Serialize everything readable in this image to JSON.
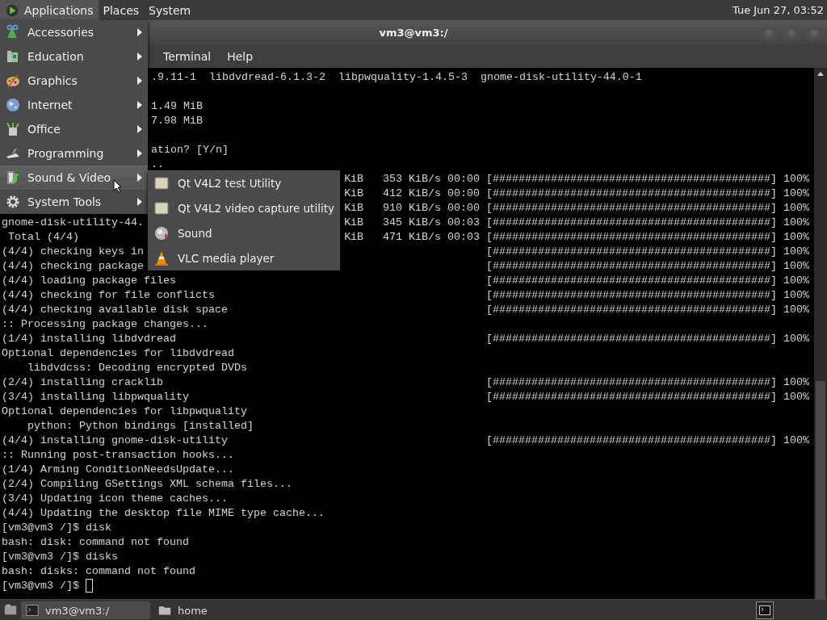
{
  "top_panel": {
    "menus": [
      {
        "label": "Applications",
        "selected": true
      },
      {
        "label": "Places",
        "selected": false
      },
      {
        "label": "System",
        "selected": false
      }
    ],
    "clock": "Tue Jun 27, 03:52"
  },
  "window": {
    "title": "vm3@vm3:/",
    "menus": [
      "Terminal",
      "Help"
    ]
  },
  "terminal": {
    "lines": [
      {
        "kind": "cut",
        "left": ".9.11-1  libdvdread-6.1.3-2  libpwquality-1.4.5-3  gnome-disk-utility-44.0-1"
      },
      {
        "kind": "blank"
      },
      {
        "kind": "cut",
        "left": "1.49 MiB"
      },
      {
        "kind": "cut",
        "left": "7.98 MiB"
      },
      {
        "kind": "blank"
      },
      {
        "kind": "cut",
        "left": "ation? [Y/n]"
      },
      {
        "kind": "cut",
        "left": ".."
      },
      {
        "kind": "line",
        "right": "KiB   353 KiB/s 00:00 [###########################################] 100%"
      },
      {
        "kind": "line",
        "right": "KiB   412 KiB/s 00:00 [###########################################] 100%"
      },
      {
        "kind": "line",
        "right": "KiB   910 KiB/s 00:00 [###########################################] 100%"
      },
      {
        "kind": "line",
        "left": "gnome-disk-utility-44.",
        "right": "KiB   345 KiB/s 00:03 [###########################################] 100%"
      },
      {
        "kind": "line",
        "left": " Total (4/4)",
        "right": "KiB   471 KiB/s 00:03 [###########################################] 100%"
      },
      {
        "kind": "line",
        "left": "(4/4) checking keys in",
        "right": "[###########################################] 100%"
      },
      {
        "kind": "line",
        "left": "(4/4) checking package",
        "right": "[###########################################] 100%"
      },
      {
        "kind": "line",
        "left": "(4/4) loading package files",
        "right": "[###########################################] 100%"
      },
      {
        "kind": "line",
        "left": "(4/4) checking for file conflicts",
        "right": "[###########################################] 100%"
      },
      {
        "kind": "line",
        "left": "(4/4) checking available disk space",
        "right": "[###########################################] 100%"
      },
      {
        "kind": "line",
        "left": ":: Processing package changes..."
      },
      {
        "kind": "line",
        "left": "(1/4) installing libdvdread",
        "right": "[###########################################] 100%"
      },
      {
        "kind": "line",
        "left": "Optional dependencies for libdvdread"
      },
      {
        "kind": "line",
        "left": "    libdvdcss: Decoding encrypted DVDs"
      },
      {
        "kind": "line",
        "left": "(2/4) installing cracklib",
        "right": "[###########################################] 100%"
      },
      {
        "kind": "line",
        "left": "(3/4) installing libpwquality",
        "right": "[###########################################] 100%"
      },
      {
        "kind": "line",
        "left": "Optional dependencies for libpwquality"
      },
      {
        "kind": "line",
        "left": "    python: Python bindings [installed]"
      },
      {
        "kind": "line",
        "left": "(4/4) installing gnome-disk-utility",
        "right": "[###########################################] 100%"
      },
      {
        "kind": "line",
        "left": ":: Running post-transaction hooks..."
      },
      {
        "kind": "line",
        "left": "(1/4) Arming ConditionNeedsUpdate..."
      },
      {
        "kind": "line",
        "left": "(2/4) Compiling GSettings XML schema files..."
      },
      {
        "kind": "line",
        "left": "(3/4) Updating icon theme caches..."
      },
      {
        "kind": "line",
        "left": "(4/4) Updating the desktop file MIME type cache..."
      },
      {
        "kind": "line",
        "left": "[vm3@vm3 /]$ disk"
      },
      {
        "kind": "line",
        "left": "bash: disk: command not found"
      },
      {
        "kind": "line",
        "left": "[vm3@vm3 /]$ disks"
      },
      {
        "kind": "line",
        "left": "bash: disks: command not found"
      },
      {
        "kind": "prompt",
        "left": "[vm3@vm3 /]$"
      }
    ]
  },
  "applications_menu": {
    "items": [
      {
        "label": "Accessories",
        "selected": false
      },
      {
        "label": "Education",
        "selected": false
      },
      {
        "label": "Graphics",
        "selected": false
      },
      {
        "label": "Internet",
        "selected": false
      },
      {
        "label": "Office",
        "selected": false
      },
      {
        "label": "Programming",
        "selected": false
      },
      {
        "label": "Sound & Video",
        "selected": true
      },
      {
        "label": "System Tools",
        "selected": false
      }
    ]
  },
  "submenu": {
    "items": [
      "Qt V4L2 test Utility",
      "Qt V4L2 video capture utility",
      "Sound",
      "VLC media player"
    ]
  },
  "taskbar": {
    "tasks": [
      {
        "label": "vm3@vm3:/",
        "selected": true
      },
      {
        "label": "home",
        "selected": false
      }
    ]
  }
}
